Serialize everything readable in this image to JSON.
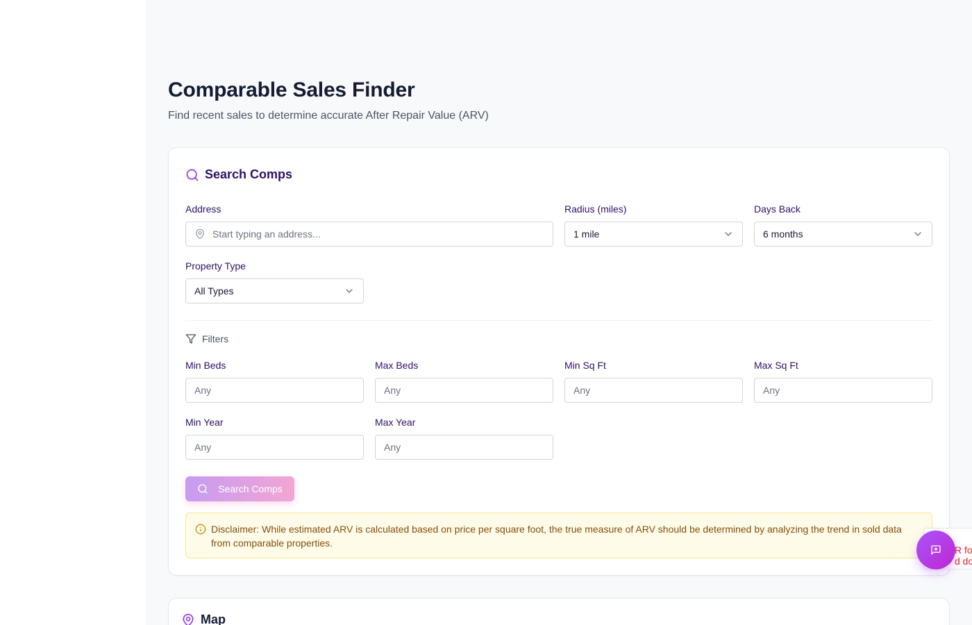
{
  "page": {
    "title": "Comparable Sales Finder",
    "subtitle": "Find recent sales to determine accurate After Repair Value (ARV)"
  },
  "search_card": {
    "title": "Search Comps",
    "address": {
      "label": "Address",
      "placeholder": "Start typing an address..."
    },
    "radius": {
      "label": "Radius (miles)",
      "value": "1 mile"
    },
    "days_back": {
      "label": "Days Back",
      "value": "6 months"
    },
    "property_type": {
      "label": "Property Type",
      "value": "All Types"
    },
    "filters_title": "Filters",
    "filters": {
      "min_beds": {
        "label": "Min Beds",
        "placeholder": "Any"
      },
      "max_beds": {
        "label": "Max Beds",
        "placeholder": "Any"
      },
      "min_sqft": {
        "label": "Min Sq Ft",
        "placeholder": "Any"
      },
      "max_sqft": {
        "label": "Max Sq Ft",
        "placeholder": "Any"
      },
      "min_year": {
        "label": "Min Year",
        "placeholder": "Any"
      },
      "max_year": {
        "label": "Max Year",
        "placeholder": "Any"
      }
    },
    "search_button": "Search Comps",
    "disclaimer": "Disclaimer: While estimated ARV is calculated based on price per square foot, the true measure of ARV should be determined by analyzing the trend in sold data from comparable properties."
  },
  "map_card": {
    "title": "Map"
  },
  "side_tab": {
    "line1": "R fo",
    "line2": "d do"
  },
  "icons": {
    "search": "search-icon",
    "map_pin": "map-pin-icon",
    "chevron": "chevron-down-icon",
    "filter": "filter-icon",
    "info": "info-icon",
    "chat": "chat-plus-icon"
  },
  "colors": {
    "accent": "#9333ea",
    "heading": "#161b33",
    "label": "#2e1065",
    "disclaimer_bg": "#fefce8",
    "disclaimer_text": "#854d0e",
    "button_gradient_start": "#c69bf2",
    "button_gradient_end": "#f2a6d3"
  }
}
